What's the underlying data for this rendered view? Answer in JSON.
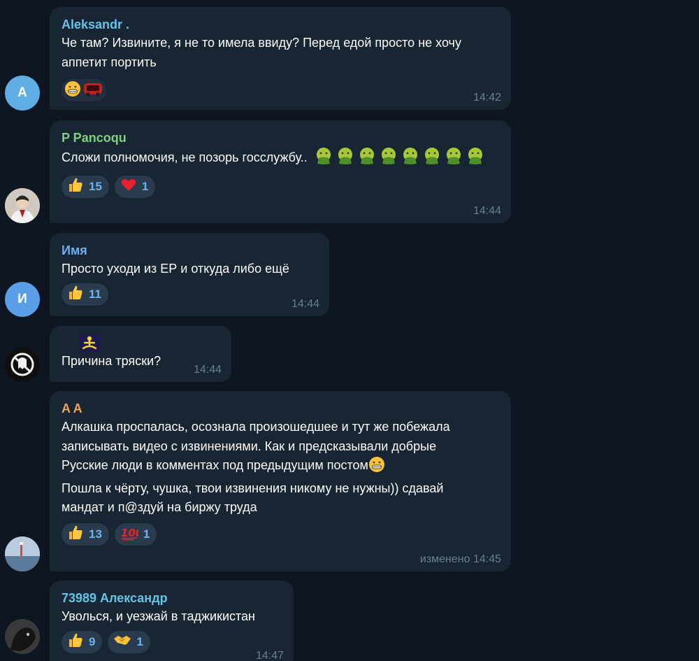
{
  "messages": [
    {
      "sender": "Aleksandr .",
      "sender_color": "#64c4e8",
      "avatar_letter": "A",
      "text": "Че там? Извините, я не то имела ввиду? Перед едой просто не хочу аппетит портить",
      "reactions": [
        {
          "icon": "grinning-face-icon"
        },
        {
          "icon": "red-car-icon"
        }
      ],
      "time": "14:42"
    },
    {
      "sender": "P Pancoqu",
      "sender_color": "#7fd17d",
      "avatar": "photo-person-icon",
      "text": "Сложи полномочия, не позорь госслужбу..",
      "text_emoji": "nauseated-face-icon",
      "text_emoji_count": 8,
      "reactions": [
        {
          "icon": "thumbs-up-icon",
          "count": "15"
        },
        {
          "icon": "red-heart-icon",
          "count": "1"
        }
      ],
      "time": "14:44"
    },
    {
      "sender": "Имя",
      "sender_color": "#6ab2f2",
      "avatar_letter": "И",
      "text": "Просто уходи из ЕР и откуда либо ещё",
      "reactions": [
        {
          "icon": "thumbs-up-icon",
          "count": "11"
        }
      ],
      "time": "14:44"
    },
    {
      "sender": "",
      "avatar": "ghostbusters-logo-icon",
      "top_emoji": "meditating-person-icon",
      "text": "Причина тряски?",
      "time": "14:44"
    },
    {
      "sender": "A A",
      "sender_color": "#f0a35c",
      "avatar": "photo-seaside-icon",
      "text": "Алкашка проспалась, осознала произошедшее и тут же побежала записывать видео с извинениями. Как и предсказывали добрые Русские люди в комментах под предыдущим постом",
      "text_emoji": "grinning-face-icon",
      "text2": "Пошла к чёрту, чушка, твои извинения никому не нужны)) сдавай мандат и п@здуй на биржу труда",
      "reactions": [
        {
          "icon": "thumbs-up-icon",
          "count": "13"
        },
        {
          "icon": "hundred-points-icon",
          "count": "1"
        }
      ],
      "time": "изменено 14:45"
    },
    {
      "sender": "73989 Александр",
      "sender_color": "#64c4e8",
      "avatar": "photo-dark-animal-icon",
      "text": "Уволься, и уезжай в таджикистан",
      "reactions": [
        {
          "icon": "thumbs-up-icon",
          "count": "9"
        },
        {
          "icon": "handshake-icon",
          "count": "1"
        }
      ],
      "time": "14:47"
    }
  ]
}
